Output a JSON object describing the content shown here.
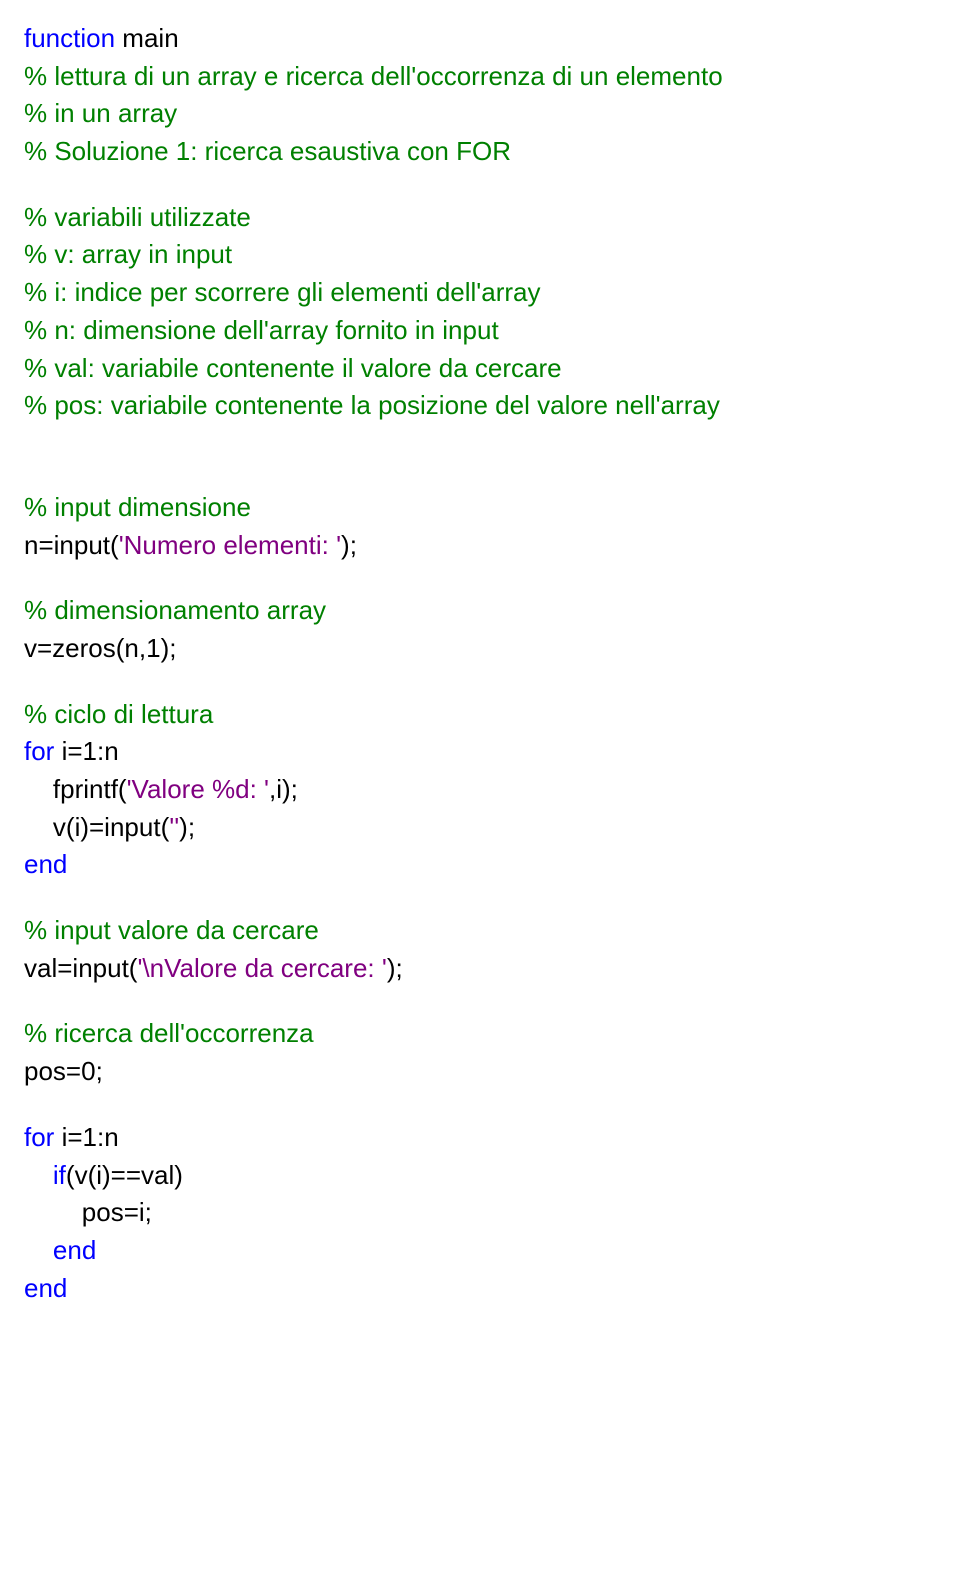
{
  "l1": {
    "kw": "function",
    "tx": " main"
  },
  "l2": "% lettura di un array e ricerca dell'occorrenza di un elemento",
  "l3": "% in un array",
  "l4": "% Soluzione 1: ricerca esaustiva con FOR",
  "l5": "% variabili utilizzate",
  "l6": "% v: array in input",
  "l7": "% i: indice per scorrere gli elementi dell'array",
  "l8": "% n: dimensione dell'array fornito in input",
  "l9": "% val: variabile contenente il valore da cercare",
  "l10": "% pos: variabile contenente la posizione del valore nell'array",
  "l11": "% input dimensione",
  "l12": {
    "tx": "n=input(",
    "str": "'Numero elementi: '",
    "tx2": ");"
  },
  "l13": "% dimensionamento array",
  "l14": "v=zeros(n,1);",
  "l15": "% ciclo di lettura",
  "l16": {
    "kw": "for",
    "tx": " i=1:n"
  },
  "l17": {
    "pad": "    ",
    "tx": "fprintf(",
    "str": "'Valore %d: '",
    "tx2": ",i);"
  },
  "l18": {
    "pad": "    ",
    "tx": "v(i)=input(",
    "str": "''",
    "tx2": ");"
  },
  "l19": "end",
  "l20": "% input valore da cercare",
  "l21": {
    "tx": "val=input(",
    "str": "'\\nValore da cercare: '",
    "tx2": ");"
  },
  "l22": "% ricerca dell'occorrenza",
  "l23": "pos=0;",
  "l24": {
    "kw": "for",
    "tx": " i=1:n"
  },
  "l25": {
    "pad": "    ",
    "kw": "if",
    "tx": "(v(i)==val)"
  },
  "l26": {
    "pad": "        ",
    "tx": "pos=i;"
  },
  "l27": {
    "pad": "    ",
    "kw": "end"
  },
  "l28": "end"
}
